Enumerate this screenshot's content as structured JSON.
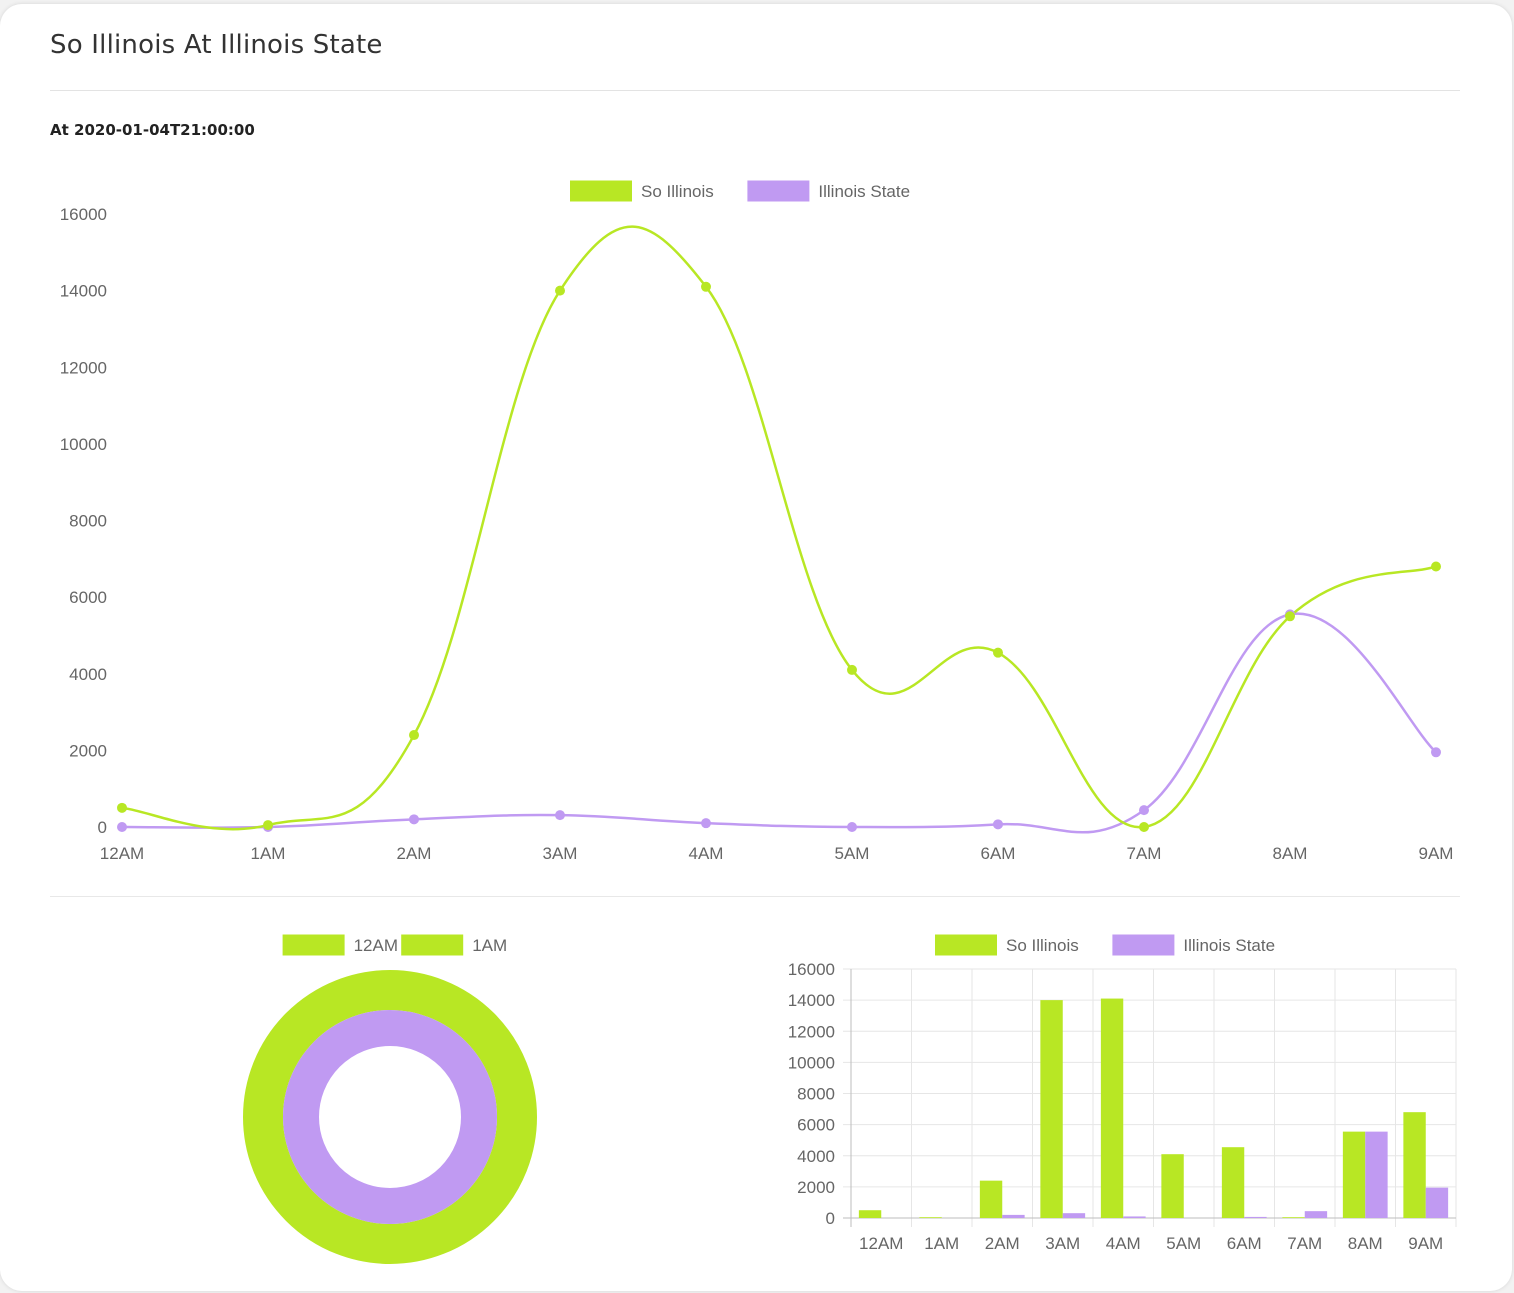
{
  "header": {
    "title": "So Illinois At Illinois State",
    "subtitle": "At 2020-01-04T21:00:00"
  },
  "colors": {
    "so_illinois": "#b8e724",
    "illinois_state": "#c09af2",
    "grid": "#e6e6e6",
    "axis": "#bdbdbd"
  },
  "chart_data": [
    {
      "type": "line",
      "categories": [
        "12AM",
        "1AM",
        "2AM",
        "3AM",
        "4AM",
        "5AM",
        "6AM",
        "7AM",
        "8AM",
        "9AM"
      ],
      "series": [
        {
          "name": "So Illinois",
          "values": [
            500,
            50,
            2400,
            14000,
            14100,
            4100,
            4550,
            0,
            5500,
            6800
          ]
        },
        {
          "name": "Illinois State",
          "values": [
            0,
            0,
            200,
            310,
            100,
            0,
            70,
            440,
            5550,
            1950
          ]
        }
      ],
      "ylim": [
        0,
        16000
      ],
      "yticks": [
        0,
        2000,
        4000,
        6000,
        8000,
        10000,
        12000,
        14000,
        16000
      ],
      "legend_position": "top-center",
      "grid": false
    },
    {
      "type": "pie",
      "style": "doughnut",
      "labels": [
        "12AM",
        "1AM"
      ],
      "rings": [
        {
          "name": "So Illinois",
          "values": [
            500,
            50
          ]
        },
        {
          "name": "Illinois State",
          "values": [
            0,
            0
          ]
        }
      ],
      "legend_position": "top-center"
    },
    {
      "type": "bar",
      "categories": [
        "12AM",
        "1AM",
        "2AM",
        "3AM",
        "4AM",
        "5AM",
        "6AM",
        "7AM",
        "8AM",
        "9AM"
      ],
      "series": [
        {
          "name": "So Illinois",
          "values": [
            500,
            50,
            2400,
            14000,
            14100,
            4100,
            4550,
            50,
            5550,
            6800
          ]
        },
        {
          "name": "Illinois State",
          "values": [
            0,
            0,
            200,
            310,
            100,
            0,
            70,
            440,
            5550,
            1950
          ]
        }
      ],
      "ylim": [
        0,
        16000
      ],
      "yticks": [
        0,
        2000,
        4000,
        6000,
        8000,
        10000,
        12000,
        14000,
        16000
      ],
      "legend_position": "top-center",
      "grid": true
    }
  ]
}
